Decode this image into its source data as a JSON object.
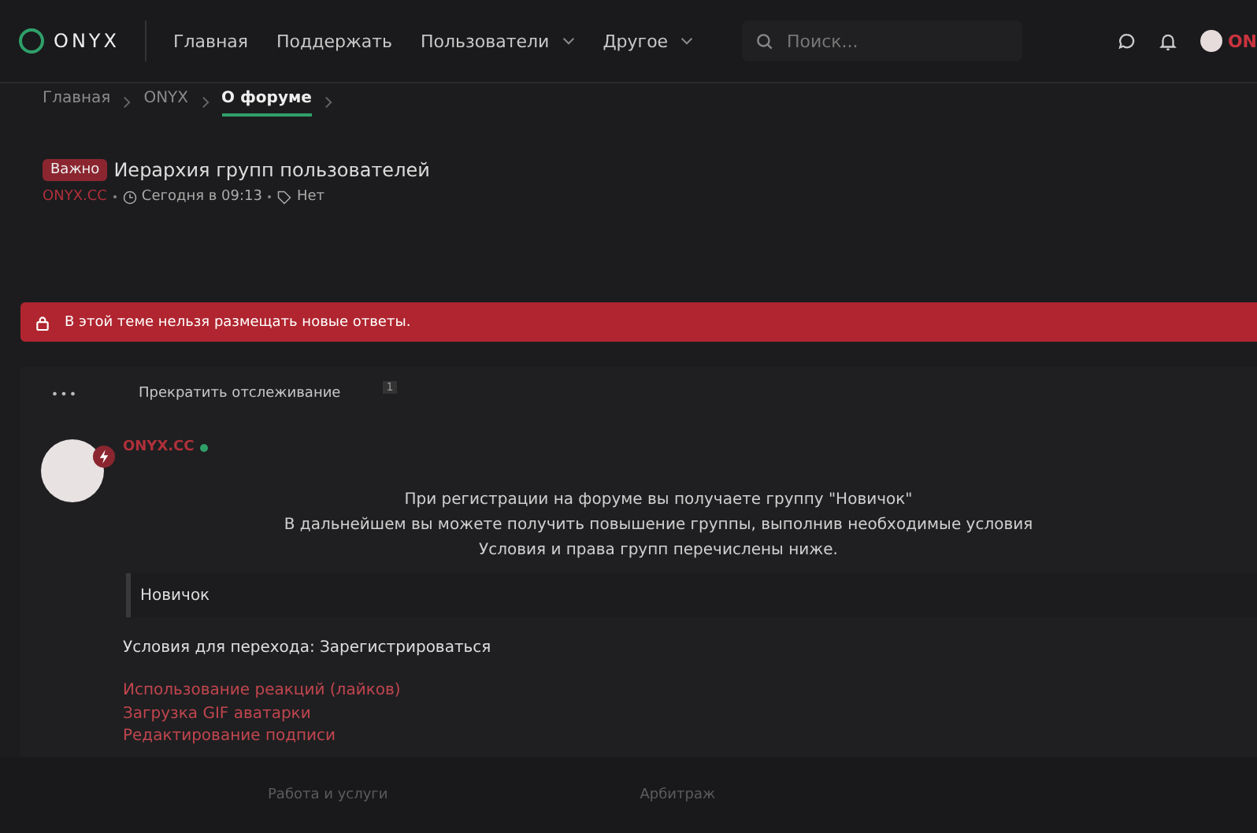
{
  "header": {
    "logo": "ONYX",
    "nav": [
      {
        "label": "Главная",
        "dropdown": false
      },
      {
        "label": "Поддержать",
        "dropdown": false
      },
      {
        "label": "Пользователи",
        "dropdown": true
      },
      {
        "label": "Другое",
        "dropdown": true
      }
    ],
    "search": {
      "placeholder": "Поиск..."
    },
    "user": "ON"
  },
  "breadcrumbs": [
    {
      "label": "Главная",
      "selected": false
    },
    {
      "label": "ONYX",
      "selected": false
    },
    {
      "label": "О форуме",
      "selected": true
    }
  ],
  "thread": {
    "badge": "Важно",
    "title": "Иерархия групп пользователей",
    "author": "ONYX.CC",
    "date": "Сегодня в 09:13",
    "tags": "Нет"
  },
  "notice": "В этой теме нельзя размещать новые ответы.",
  "actions": {
    "more": "•••",
    "watch": "Прекратить отслеживание",
    "count": "1"
  },
  "post": {
    "author": "ONYX.CC",
    "online": true,
    "intro": [
      "При регистрации на форуме вы получаете группу \"Новичок\"",
      "В дальнейшем вы можете получить повышение группы, выполнив необходимые условия",
      "Условия и права групп перечислены ниже."
    ],
    "group": "Новичок",
    "condition": "Условия для перехода: Зарегистрироваться",
    "perks": [
      "Использование реакций (лайков)",
      "Загрузка GIF аватарки",
      "Редактирование подписи"
    ]
  },
  "footer_menu": [
    "Работа и услуги",
    "Арбитраж"
  ]
}
